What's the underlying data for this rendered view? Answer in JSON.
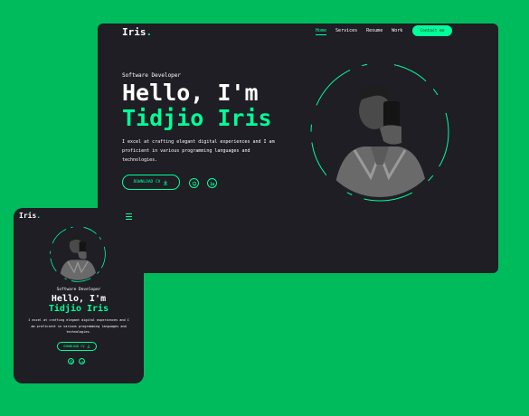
{
  "desktop": {
    "logo": {
      "text": "Iris",
      "dot": "."
    },
    "nav": [
      "Home",
      "Services",
      "Resume",
      "Work"
    ],
    "contact_label": "Contact me",
    "hero": {
      "role": "Software Developer",
      "hello": "Hello, I'm",
      "name": "Tidjio Iris",
      "description": "I excel at crafting elegant digital experiences and I am proficient in various programming languages and technologies.",
      "download_label": "DOWNLOAD CV"
    },
    "social_icons": [
      "github-icon",
      "linkedin-icon"
    ]
  },
  "mobile": {
    "logo": {
      "text": "Iris",
      "dot": "."
    },
    "hero": {
      "role": "Software Developer",
      "hello": "Hello, I'm",
      "name": "Tidjio Iris",
      "description": "I excel at crafting elegant digital experiences and I am proficient in various programming languages and technologies.",
      "download_label": "DOWNLOAD CV"
    }
  },
  "colors": {
    "background": "#00bb5c",
    "surface": "#1e1e24",
    "accent": "#00ff99"
  }
}
